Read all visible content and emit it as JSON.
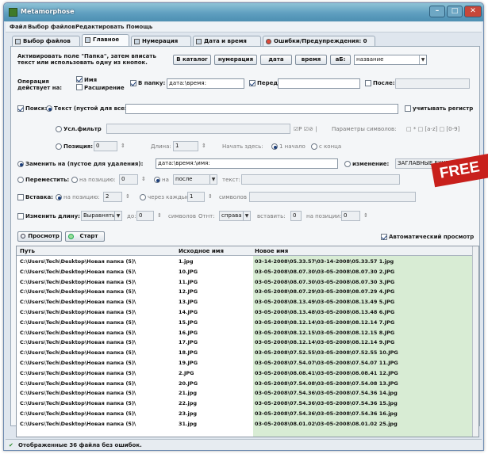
{
  "window": {
    "title": "Metamorphose",
    "min": "–",
    "max": "□",
    "close": "✕"
  },
  "menu": [
    "Файл",
    "Выбор файлов",
    "Редактировать",
    "Помощь"
  ],
  "tabs": [
    "Выбор файлов",
    "Главное",
    "Нумерация",
    "Дата и время",
    "Ошибки/Предупреждения: 0"
  ],
  "row1": {
    "label1": "Активировать поле \"Папка\", затем вписать",
    "label2": "текст или использовать одну из кнопок.",
    "buttons": [
      "В каталог",
      "нумерация",
      "дата",
      "время",
      "аБ:",
      "название"
    ]
  },
  "row2": {
    "op1": "Операция",
    "op2": "действует на:",
    "name": "Имя",
    "ext": "Расширение",
    "infolder": "В папку:",
    "folder_value": "дата:\\время:",
    "before": "Перед:",
    "after": "После:"
  },
  "search": {
    "label": "Поиск:",
    "text": "Текст (пустой для всех)",
    "case": "учитывать регистр",
    "regex": "Усл.фильтр",
    "regex_opts": "Параметры символов:",
    "regex_flags": "□ *  □ [a-z]  □ [0-9]",
    "pos": "Позиция:",
    "pos_val": "0",
    "length": "Длина:",
    "length_val": "1",
    "count_from": "Начать здесь:",
    "start": "1 начало",
    "end": "с конца"
  },
  "replace": {
    "label": "Заменить на (пустое для удаления):",
    "value": "дата:\\время:\\имя:",
    "name_opt": "изменение:",
    "case_dd": "ЗАГЛАВНЫЕ БУКВЫ"
  },
  "move": {
    "label": "Переместить:",
    "at_pos": "на позицию:",
    "pos_val": "0",
    "to": "на",
    "dd": "после",
    "text": "текст:"
  },
  "insert": {
    "label": "Вставка:",
    "at_pos": "на позицию:",
    "val": "2",
    "every": "через каждые",
    "every_val": "1",
    "symbols": "символов"
  },
  "length_change": {
    "label": "Изменить длину:",
    "align": "Выравнять",
    "to": "до:",
    "to_val": "0",
    "symbols": "символов",
    "pad": "Отнт:",
    "side": "справа",
    "insert": "вставить:",
    "insert_val": "0",
    "pos": "на позиции:",
    "pos_val": "0"
  },
  "actions": {
    "preview": "Просмотр",
    "go": "Старт",
    "auto": "Автоматический просмотр"
  },
  "badge": "FREE",
  "table": {
    "headers": [
      "Путь",
      "Исходное имя",
      "Новое имя"
    ],
    "path": "C:\\Users\\Tech\\Desktop\\Новая папка (5)\\",
    "rows": [
      [
        "1.jpg",
        "03-14-2008\\05.33.57\\03-14-2008\\05.33.57 1.jpg"
      ],
      [
        "10.JPG",
        "03-05-2008\\08.07.30\\03-05-2008\\08.07.30 2.JPG"
      ],
      [
        "11.JPG",
        "03-05-2008\\08.07.30\\03-05-2008\\08.07.30 3.JPG"
      ],
      [
        "12.JPG",
        "03-05-2008\\08.07.29\\03-05-2008\\08.07.29 4.JPG"
      ],
      [
        "13.JPG",
        "03-05-2008\\08.13.49\\03-05-2008\\08.13.49 5.JPG"
      ],
      [
        "14.JPG",
        "03-05-2008\\08.13.48\\03-05-2008\\08.13.48 6.JPG"
      ],
      [
        "15.JPG",
        "03-05-2008\\08.12.14\\03-05-2008\\08.12.14 7.JPG"
      ],
      [
        "16.JPG",
        "03-05-2008\\08.12.15\\03-05-2008\\08.12.15 8.JPG"
      ],
      [
        "17.JPG",
        "03-05-2008\\08.12.14\\03-05-2008\\08.12.14 9.JPG"
      ],
      [
        "18.JPG",
        "03-05-2008\\07.52.55\\03-05-2008\\07.52.55 10.JPG"
      ],
      [
        "19.JPG",
        "03-05-2008\\07.54.07\\03-05-2008\\07.54.07 11.JPG"
      ],
      [
        "2.JPG",
        "03-05-2008\\08.08.41\\03-05-2008\\08.08.41 12.JPG"
      ],
      [
        "20.JPG",
        "03-05-2008\\07.54.08\\03-05-2008\\07.54.08 13.JPG"
      ],
      [
        "21.jpg",
        "03-05-2008\\07.54.36\\03-05-2008\\07.54.36 14.jpg"
      ],
      [
        "22.jpg",
        "03-05-2008\\07.54.36\\03-05-2008\\07.54.36 15.jpg"
      ],
      [
        "23.jpg",
        "03-05-2008\\07.54.36\\03-05-2008\\07.54.36 16.jpg"
      ],
      [
        "31.jpg",
        "03-05-2008\\08.01.02\\03-05-2008\\08.01.02 25.jpg"
      ]
    ]
  },
  "status": "Отображенные 36 файла без ошибок.",
  "colors": {
    "title": "#5f9fc0",
    "newname_bg": "#d8ecd4",
    "badge": "#c8201c"
  }
}
